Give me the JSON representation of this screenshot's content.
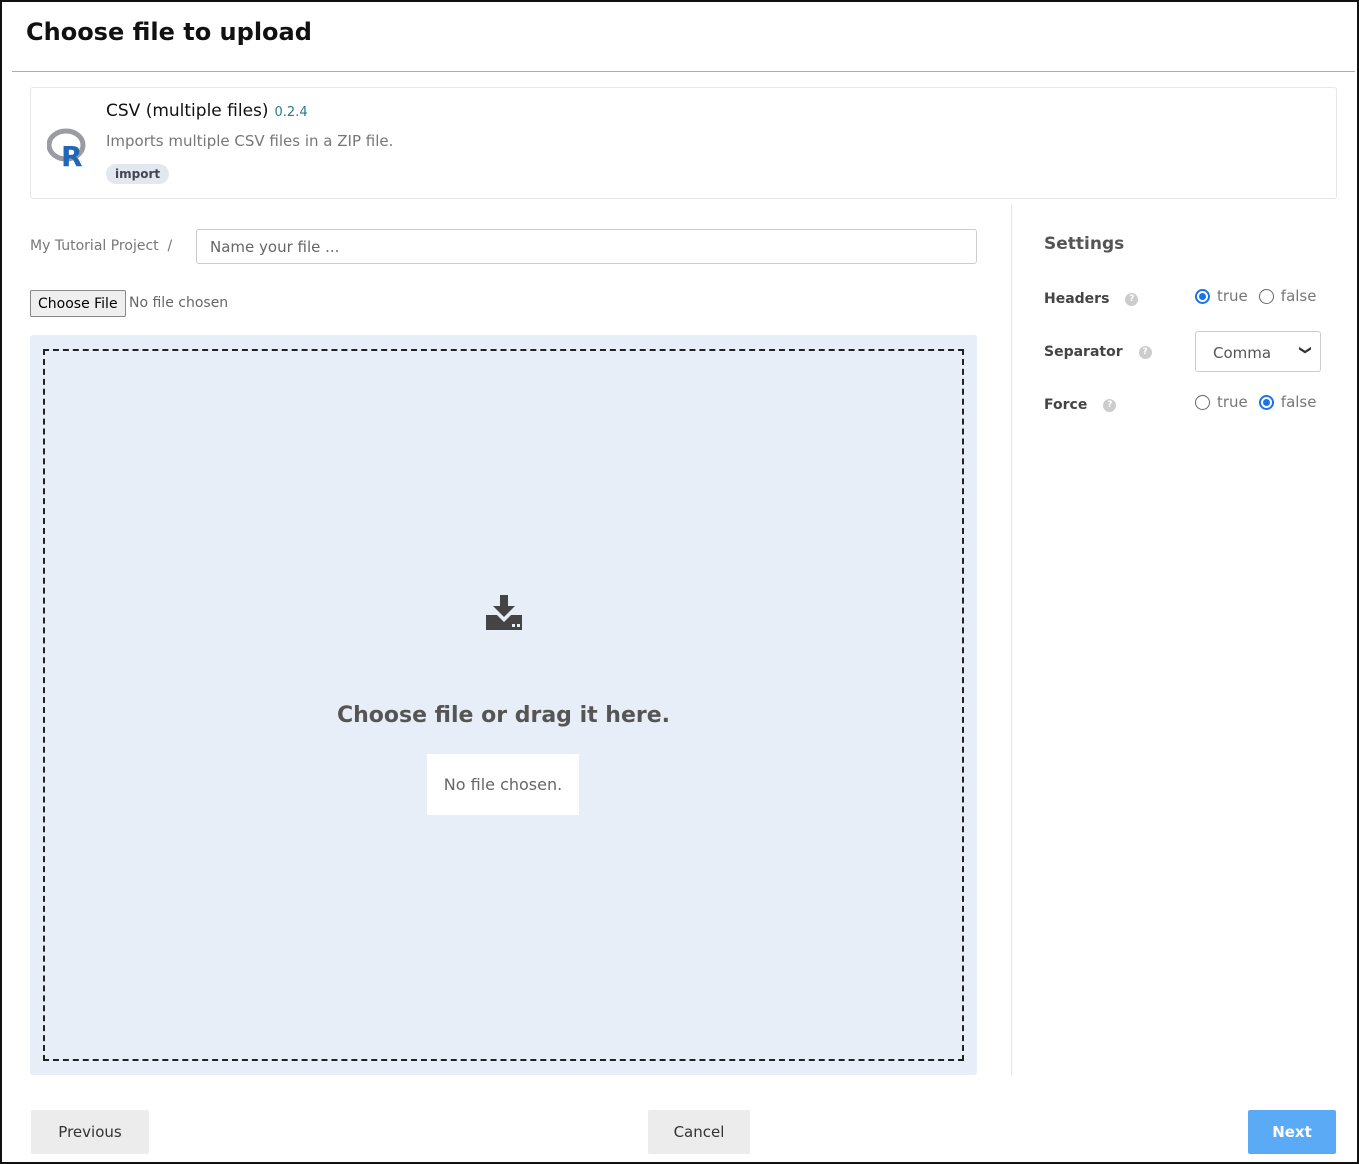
{
  "title": "Choose file to upload",
  "plugin": {
    "name": "CSV (multiple files)",
    "version": "0.2.4",
    "description": "Imports multiple CSV files in a ZIP file.",
    "tag": "import",
    "logo": "R"
  },
  "breadcrumb": {
    "project": "My Tutorial Project",
    "separator": "/"
  },
  "file_name": {
    "value": "",
    "placeholder": "Name your file ..."
  },
  "file_input": {
    "button": "Choose File",
    "status": "No file chosen"
  },
  "dropzone": {
    "icon": "download-icon",
    "text": "Choose file or drag it here.",
    "status": "No file chosen."
  },
  "settings": {
    "title": "Settings",
    "headers": {
      "label": "Headers",
      "options": [
        "true",
        "false"
      ],
      "selected": "true"
    },
    "separator": {
      "label": "Separator",
      "value": "Comma"
    },
    "force": {
      "label": "Force",
      "options": [
        "true",
        "false"
      ],
      "selected": "false"
    }
  },
  "footer": {
    "previous": "Previous",
    "cancel": "Cancel",
    "next": "Next"
  },
  "colors": {
    "accent": "#1a73e8",
    "next_button": "#5aaaf6",
    "dropzone_bg": "#e8eef8"
  }
}
